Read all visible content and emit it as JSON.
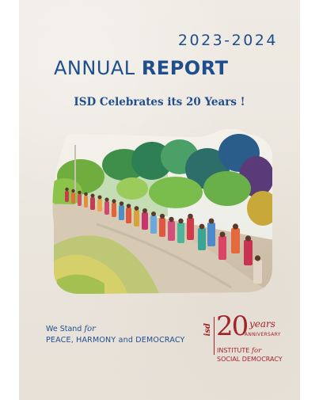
{
  "header": {
    "years": "2023-2024",
    "title_light": "ANNUAL",
    "title_bold": "REPORT",
    "tagline": "ISD Celebrates its 20 Years !"
  },
  "footer": {
    "stand_prefix": "We Stand",
    "stand_for": "for",
    "motto": "PEACE, HARMONY and DEMOCRACY"
  },
  "logo": {
    "initials": "isd",
    "number": "20",
    "years_word": "years",
    "anniversary": "ANNIVERSARY",
    "institute": "INSTITUTE",
    "institute_for": "for",
    "social_democracy": "SOCIAL DEMOCRACY"
  },
  "colors": {
    "primary_blue": "#1f4e8c",
    "logo_red": "#a3232a",
    "paper": "#ece7df"
  },
  "illustration": "watercolor painting of a procession of women in colorful saris walking along a hillside path beneath green trees"
}
